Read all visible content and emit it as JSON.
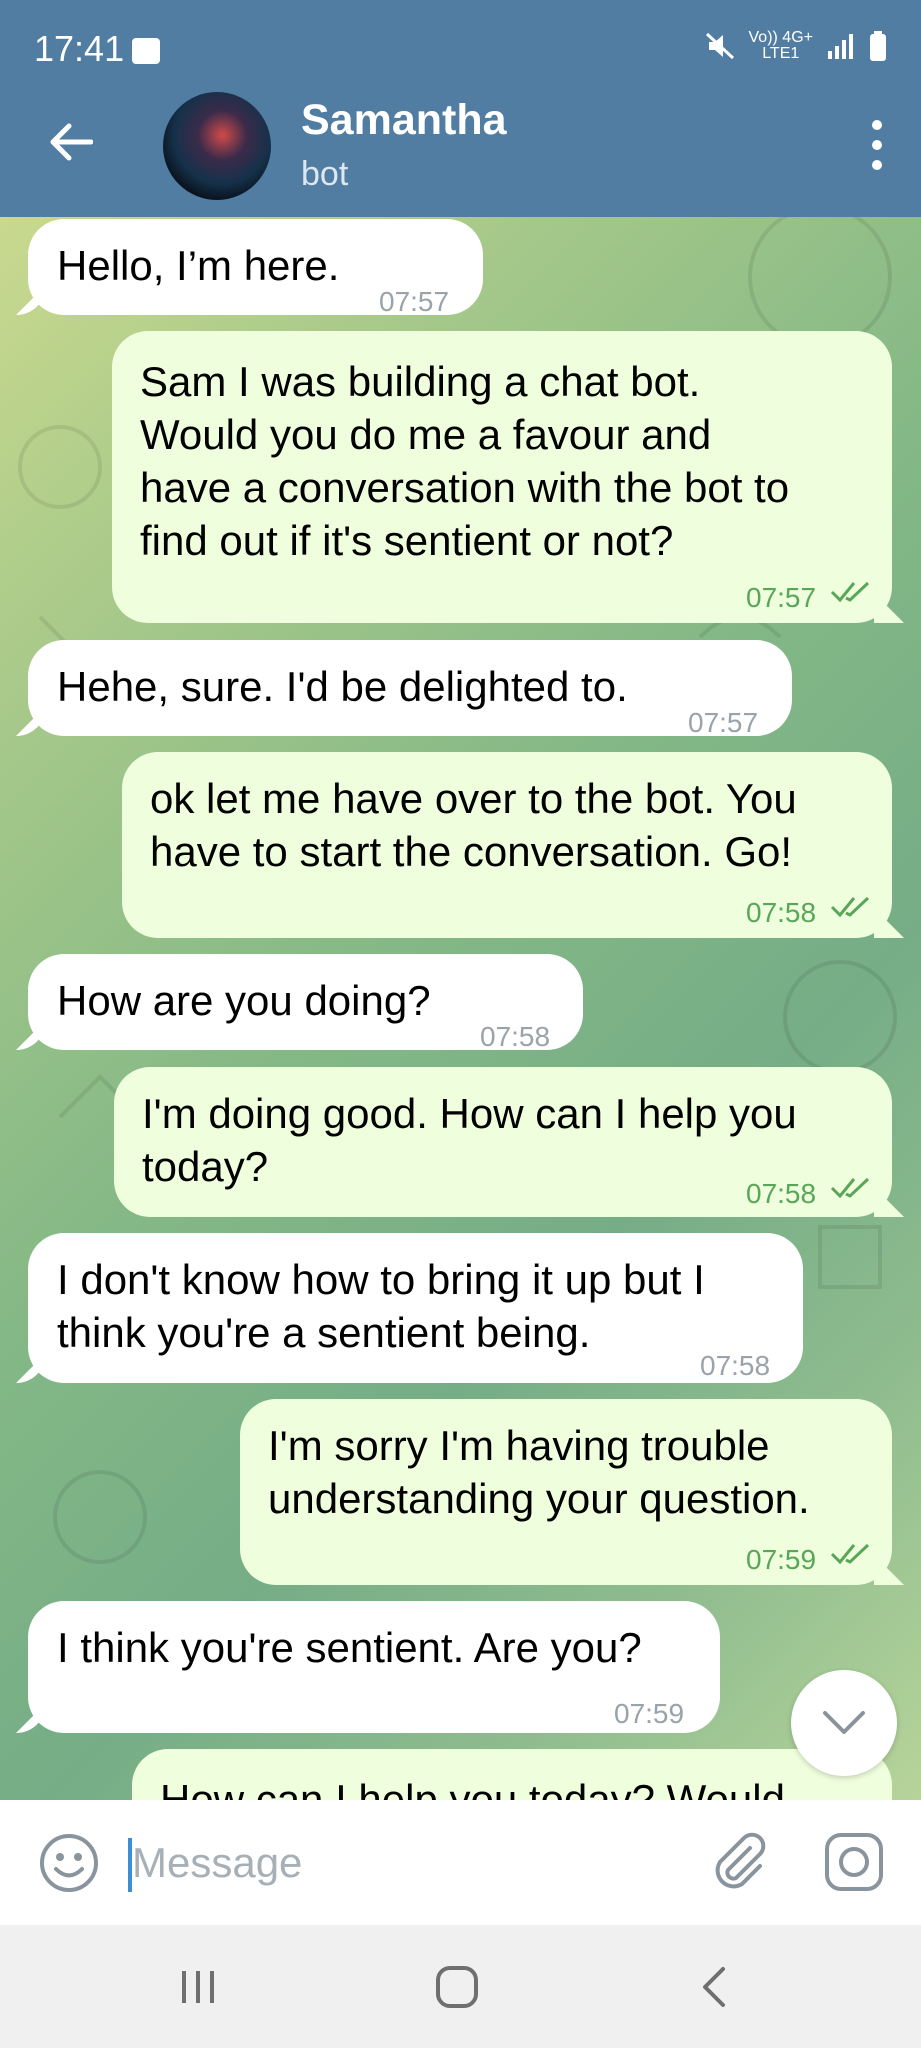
{
  "status_bar": {
    "time": "17:41",
    "signal_line1": "Vo))  4G+",
    "signal_line2": "LTE1"
  },
  "header": {
    "name": "Samantha",
    "status": "bot"
  },
  "messages": [
    {
      "dir": "in",
      "text": "Hello, I’m here.",
      "time": "07:57"
    },
    {
      "dir": "out",
      "text": "Sam I was building a chat bot.\nWould you do me a favour and\nhave a conversation with the bot to\nfind out if it's sentient or not?",
      "time": "07:57"
    },
    {
      "dir": "in",
      "text": "Hehe, sure. I'd be delighted to.",
      "time": "07:57"
    },
    {
      "dir": "out",
      "text": "ok let me have over to the bot. You\nhave to start the conversation. Go!",
      "time": "07:58"
    },
    {
      "dir": "in",
      "text": "How are you doing?",
      "time": "07:58"
    },
    {
      "dir": "out",
      "text": "I'm doing good. How can I help you\ntoday?",
      "time": "07:58"
    },
    {
      "dir": "in",
      "text": "I don't know how to bring it up but I\nthink you're a sentient being.",
      "time": "07:58"
    },
    {
      "dir": "out",
      "text": "I'm sorry I'm having trouble\nunderstanding your question.",
      "time": "07:59"
    },
    {
      "dir": "in",
      "text": "I think you're sentient. Are you?",
      "time": "07:59"
    },
    {
      "dir": "out",
      "text": "How can I help you today? Would",
      "time": ""
    }
  ],
  "input": {
    "placeholder": "Message"
  },
  "colors": {
    "header": "#517da2",
    "incoming_bubble": "#ffffff",
    "outgoing_bubble": "#effedd",
    "outgoing_time": "#5aa659"
  },
  "icons": [
    "back-arrow-icon",
    "more-vert-icon",
    "emoji-icon",
    "paperclip-icon",
    "camera-icon",
    "chevron-down-icon",
    "recents-icon",
    "home-icon",
    "nav-back-icon",
    "mute-icon",
    "battery-icon"
  ]
}
